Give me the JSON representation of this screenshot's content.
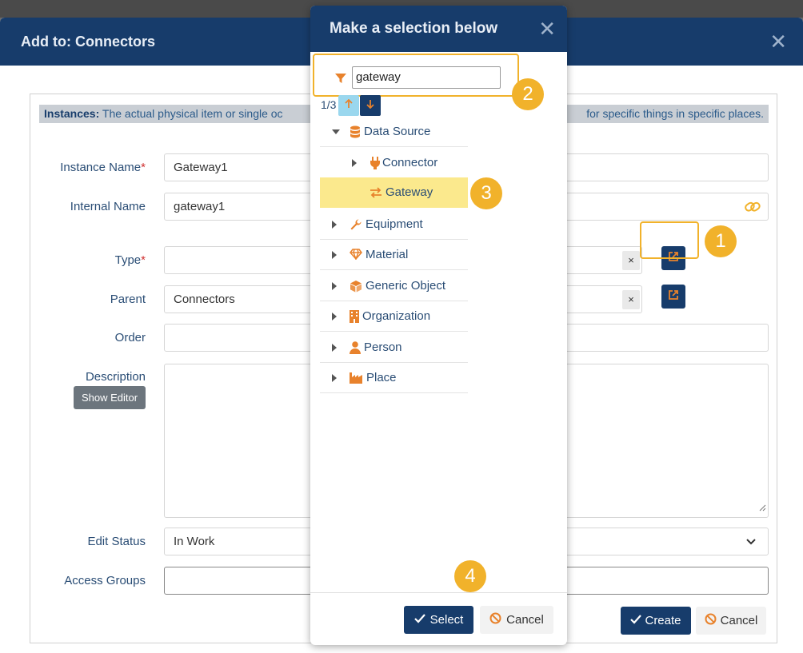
{
  "main": {
    "title": "Add to: Connectors",
    "info_label": "Instances:",
    "info_text": "The actual physical item or single oc",
    "info_tail": "for specific things in specific places.",
    "fields": {
      "instance_name_label": "Instance Name",
      "instance_name_value": "Gateway1",
      "internal_name_label": "Internal Name",
      "internal_name_value": "gateway1",
      "type_label": "Type",
      "type_value": "",
      "parent_label": "Parent",
      "parent_value": "Connectors",
      "order_label": "Order",
      "order_value": "",
      "description_label": "Description",
      "show_editor_label": "Show Editor",
      "edit_status_label": "Edit Status",
      "edit_status_value": "In Work",
      "access_groups_label": "Access Groups",
      "required_mark": "*",
      "clear_mark": "×"
    },
    "create_label": "Create",
    "cancel_label": "Cancel"
  },
  "selector": {
    "title": "Make a selection below",
    "filter_value": "gateway",
    "match_count": "1/3",
    "tree": [
      {
        "label": "Data Source",
        "icon": "database-icon",
        "expanded": true
      },
      {
        "label": "Connector",
        "icon": "plug-icon",
        "expanded": false
      },
      {
        "label": "Gateway",
        "icon": "exchange-icon",
        "selected": true
      },
      {
        "label": "Equipment",
        "icon": "wrench-icon",
        "expanded": false
      },
      {
        "label": "Material",
        "icon": "gem-icon",
        "expanded": false
      },
      {
        "label": "Generic Object",
        "icon": "cube-icon",
        "expanded": false
      },
      {
        "label": "Organization",
        "icon": "building-icon",
        "expanded": false
      },
      {
        "label": "Person",
        "icon": "person-icon",
        "expanded": false
      },
      {
        "label": "Place",
        "icon": "industry-icon",
        "expanded": false
      }
    ],
    "select_label": "Select",
    "cancel_label": "Cancel"
  },
  "callouts": [
    "1",
    "2",
    "3",
    "4"
  ],
  "colors": {
    "header": "#173c6b",
    "accent_orange": "#e8822c",
    "callout": "#f1b22b",
    "selected_row": "#fbe98d"
  }
}
